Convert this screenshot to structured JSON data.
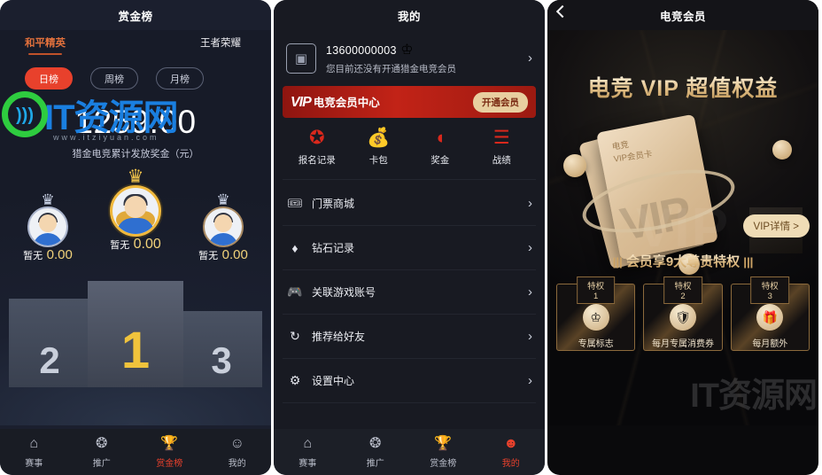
{
  "panel1": {
    "header_title": "赏金榜",
    "game_tabs": [
      {
        "label": "和平精英",
        "active": true
      },
      {
        "label": "王者荣耀",
        "active": false
      }
    ],
    "range_pills": [
      {
        "label": "日榜",
        "active": true
      },
      {
        "label": "周榜",
        "active": false
      },
      {
        "label": "月榜",
        "active": false
      }
    ],
    "amount": "1259.00",
    "amount_caption": "猎金电竞累计发放奖金（元）",
    "podium": [
      {
        "rank": "1",
        "name": "暂无",
        "score": "0.00",
        "crown": "♛"
      },
      {
        "rank": "2",
        "name": "暂无",
        "score": "0.00",
        "crown": "♛"
      },
      {
        "rank": "3",
        "name": "暂无",
        "score": "0.00",
        "crown": "♛"
      }
    ],
    "nav": [
      {
        "label": "赛事",
        "icon": "⌂",
        "active": false
      },
      {
        "label": "推广",
        "icon": "❂",
        "active": false
      },
      {
        "label": "赏金榜",
        "icon": "🏆",
        "active": true
      },
      {
        "label": "我的",
        "icon": "☺",
        "active": false
      }
    ]
  },
  "panel2": {
    "header_title": "我的",
    "profile": {
      "avatar_icon": "contact-card-icon",
      "name": "13600000003",
      "crown": "♔",
      "subtitle": "您目前还没有开通猎金电竞会员",
      "chevron": "›"
    },
    "vip_banner": {
      "vip_mark": "VIP",
      "title": "电竞会员中心",
      "button": "开通会员"
    },
    "quick_actions": [
      {
        "label": "报名记录",
        "icon": "✪"
      },
      {
        "label": "卡包",
        "icon": "💰"
      },
      {
        "label": "奖金",
        "icon": "◖"
      },
      {
        "label": "战绩",
        "icon": "☰"
      }
    ],
    "menu": [
      {
        "label": "门票商城",
        "icon": "🎟",
        "chevron": "›"
      },
      {
        "label": "钻石记录",
        "icon": "♦",
        "chevron": "›"
      },
      {
        "label": "关联游戏账号",
        "icon": "🎮",
        "chevron": "›"
      },
      {
        "label": "推荐给好友",
        "icon": "↻",
        "chevron": "›"
      },
      {
        "label": "设置中心",
        "icon": "⚙",
        "chevron": "›"
      }
    ],
    "nav": [
      {
        "label": "赛事",
        "icon": "⌂",
        "active": false
      },
      {
        "label": "推广",
        "icon": "❂",
        "active": false
      },
      {
        "label": "赏金榜",
        "icon": "🏆",
        "active": false
      },
      {
        "label": "我的",
        "icon": "☻",
        "active": true
      }
    ]
  },
  "panel3": {
    "header_title": "电竞会员",
    "back_icon": "chevron-left-icon",
    "hero_title": "电竞 VIP 超值权益",
    "card_line1": "电竞",
    "card_line2": "VIP会员卡",
    "card_ghost": "VIP",
    "bg_ghost": "VIP",
    "detail_button": "VIP详情 >",
    "privileges_heading": "会员享9大尊贵特权",
    "heading_bars_left": "|||",
    "heading_bars_right": "|||",
    "privileges": [
      {
        "tag": "特权1",
        "icon": "♔",
        "label": "专属标志"
      },
      {
        "tag": "特权2",
        "icon": "🛡",
        "label": "每月专属消费券"
      },
      {
        "tag": "特权3",
        "icon": "🎁",
        "label": "每月额外"
      }
    ]
  },
  "watermark": {
    "text": "IT资源网",
    "sub": "www.itziyuan.com",
    "corner": "IT资源网"
  },
  "colors": {
    "accent_red": "#e8412c",
    "gold": "#f0c33c",
    "vip_red": "#c22317",
    "tab_orange": "#e0703c"
  }
}
